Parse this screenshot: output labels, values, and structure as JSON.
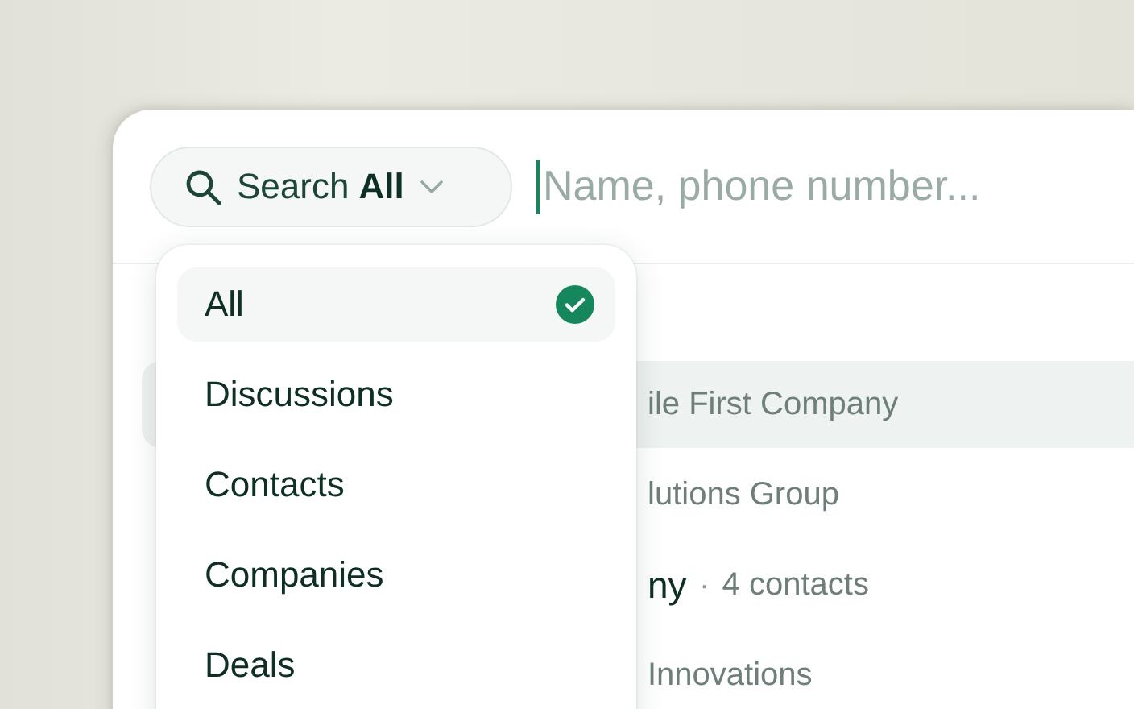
{
  "search": {
    "label": "Search",
    "scope": "All",
    "placeholder": "Name, phone number..."
  },
  "scope_menu": [
    {
      "label": "All",
      "selected": true
    },
    {
      "label": "Discussions",
      "selected": false
    },
    {
      "label": "Contacts",
      "selected": false
    },
    {
      "label": "Companies",
      "selected": false
    },
    {
      "label": "Deals",
      "selected": false
    }
  ],
  "results": [
    {
      "title": "ile First Company",
      "highlighted": true,
      "emphasized": false
    },
    {
      "title": "lutions Group",
      "highlighted": false,
      "emphasized": false
    },
    {
      "title": "ny",
      "separator": "·",
      "detail": "4 contacts",
      "highlighted": false,
      "emphasized": true
    },
    {
      "title": "Innovations",
      "highlighted": false,
      "emphasized": false
    }
  ]
}
